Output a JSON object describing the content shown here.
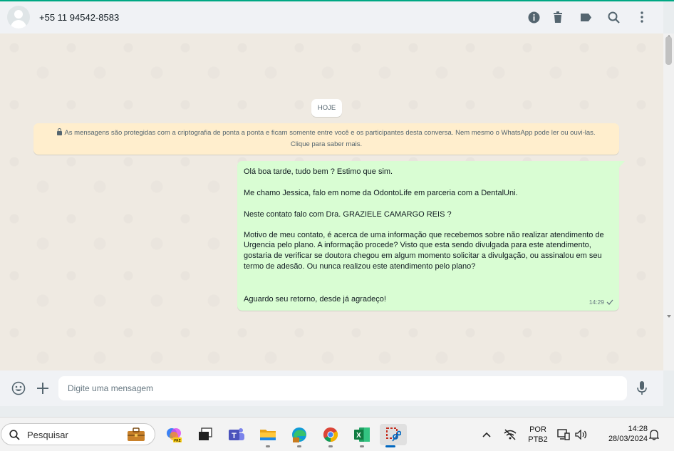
{
  "header": {
    "contact": "+55 11 94542-8583",
    "icons": [
      "info-icon",
      "trash-icon",
      "label-icon",
      "search-icon",
      "menu-icon"
    ]
  },
  "chat": {
    "date_chip": "HOJE",
    "encryption_line1": "As mensagens são protegidas com a criptografia de ponta a ponta e ficam somente entre você e os participantes desta conversa. Nem mesmo o WhatsApp pode ler ou ouvi-las.",
    "encryption_line2": "Clique para saber mais.",
    "message": {
      "lines": [
        "Olá boa tarde, tudo bem ? Estimo que sim.",
        "Me chamo Jessica, falo em nome da OdontoLife em parceria com a DentalUni.",
        "Neste contato falo com Dra. GRAZIELE CAMARGO REIS ?",
        "Motivo de meu contato, é acerca de uma informação que recebemos sobre não realizar atendimento de",
        "Urgencia pelo plano. A informação procede? Visto que esta sendo divulgada para este atendimento,",
        "gostaria de verificar se doutora chegou em algum momento solicitar a divulgação, ou assinalou em seu",
        "termo de adesão. Ou nunca realizou este atendimento pelo plano?",
        "Aguardo seu retorno, desde já agradeço!"
      ],
      "time": "14:29",
      "status": "sent"
    }
  },
  "composer": {
    "placeholder": "Digite uma mensagem"
  },
  "taskbar": {
    "search_label": "Pesquisar",
    "apps": [
      "work-briefcase",
      "copilot-pre",
      "task-view",
      "teams",
      "file-explorer",
      "edge",
      "chrome",
      "excel",
      "snipping-tool"
    ],
    "lang_top": "POR",
    "lang_bottom": "PTB2",
    "time": "14:28",
    "date": "28/03/2024"
  }
}
